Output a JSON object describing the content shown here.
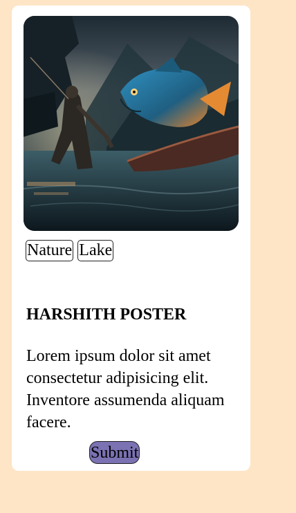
{
  "card": {
    "image": {
      "icon": "fisherman-and-leaping-fish-illustration"
    },
    "tags": [
      "Nature",
      "Lake"
    ],
    "title": "HARSHITH POSTER",
    "description": "Lorem ipsum dolor sit amet consectetur adipisicing elit. Inventore assumenda aliquam facere.",
    "submit_label": "Submit"
  },
  "colors": {
    "page_background": "#fde5c6",
    "card_background": "#ffffff",
    "submit_background": "#7a72b2"
  }
}
